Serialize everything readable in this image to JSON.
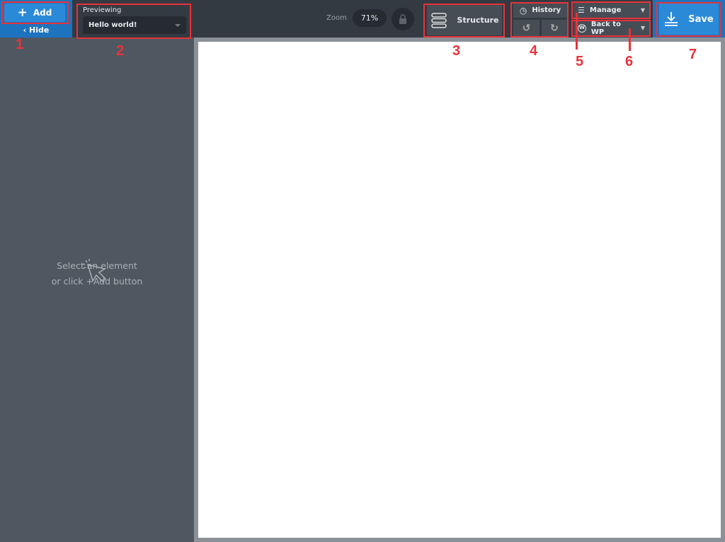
{
  "toolbar": {
    "add_label": "Add",
    "hide_label": "Hide",
    "previewing_label": "Previewing",
    "previewing_value": "Hello world!",
    "zoom_label": "Zoom",
    "zoom_value": "71%",
    "structure_label": "Structure",
    "history_label": "History",
    "manage_label": "Manage",
    "back_to_wp_label": "Back to WP",
    "save_label": "Save"
  },
  "left_panel": {
    "empty_line1": "Select an element",
    "empty_line2": "or click +Add button"
  },
  "annotations": [
    "1",
    "2",
    "3",
    "4",
    "5",
    "6",
    "7"
  ],
  "colors": {
    "accent": "#2a8ad8",
    "annotation": "#e8323a",
    "topbar": "#343a42",
    "panel": "#4f5861"
  }
}
